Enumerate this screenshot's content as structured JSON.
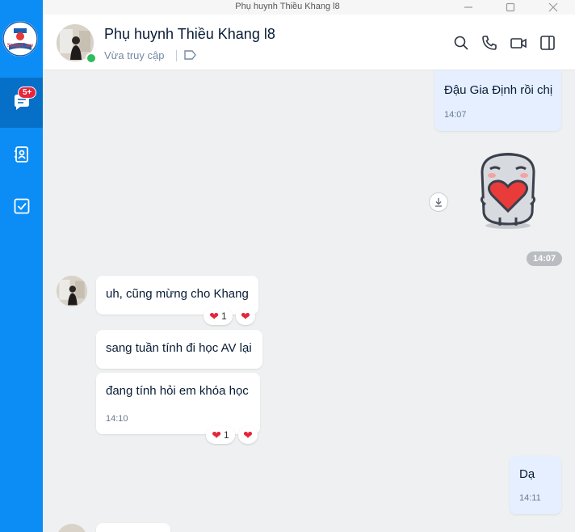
{
  "window": {
    "title": "Phụ huynh Thiều Khang l8"
  },
  "rail": {
    "badge": "5+"
  },
  "header": {
    "name": "Phụ huynh Thiều Khang l8",
    "status": "Vừa truy cập"
  },
  "messages": {
    "m1": {
      "text": "Đậu Gia Định rồi chị",
      "time": "14:07"
    },
    "sticker_time": "14:07",
    "m2": {
      "text": "uh, cũng mừng cho Khang",
      "reaction_count": "1"
    },
    "m3": {
      "text": "sang tuần tính đi học AV lại"
    },
    "m4": {
      "text": "đang tính hỏi em khóa học",
      "time": "14:10",
      "reaction_count": "1"
    },
    "m5": {
      "text": "Dạ",
      "time": "14:11"
    }
  },
  "colors": {
    "rail": "#0b8df5",
    "self_bubble": "#e5efff",
    "reaction": "#e3263b"
  }
}
